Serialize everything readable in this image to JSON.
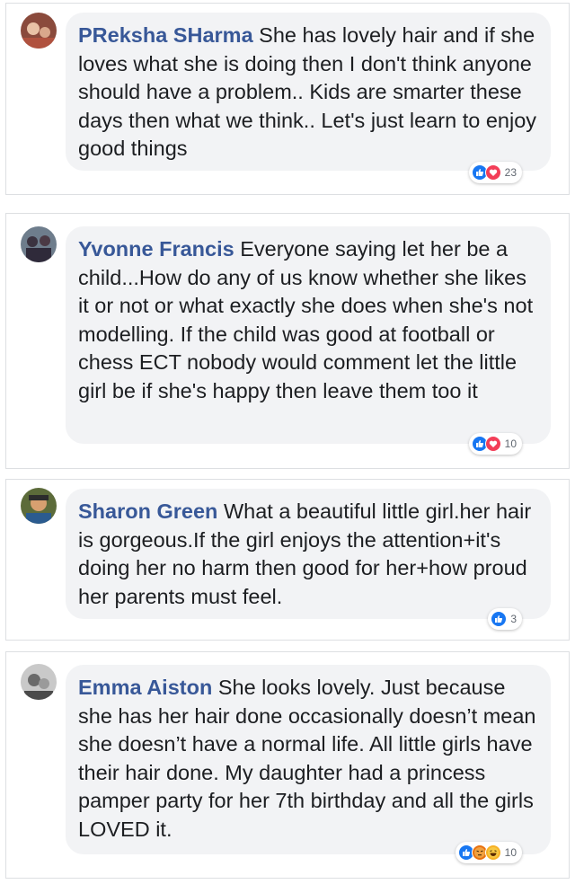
{
  "colors": {
    "author": "#385898",
    "bubble": "#f2f3f5",
    "like": "#1877f2",
    "love": "#f33e58",
    "haha": "#f7b125"
  },
  "comments": [
    {
      "author": "PReksha SHarma",
      "text": "She has lovely hair and if she loves what she is doing then I don't think anyone should have a problem.. Kids are smarter these days then what we think.. Let's just learn to enjoy good things",
      "reactions": [
        "like-icon",
        "love-icon"
      ],
      "count": "23"
    },
    {
      "author": "Yvonne Francis",
      "text": "Everyone saying let her be a child...How do any of us know whether she likes it or not or what exactly she does when she's not modelling. If the child was good at football or chess ECT nobody would comment let the little girl be if she's happy then leave them too it",
      "reactions": [
        "like-icon",
        "love-icon"
      ],
      "count": "10"
    },
    {
      "author": "Sharon Green",
      "text": "What a beautiful little girl.her hair is gorgeous.If the girl enjoys the attention+it's doing her no harm then good for her+how proud her parents must feel.",
      "reactions": [
        "like-icon"
      ],
      "count": "3"
    },
    {
      "author": "Emma Aiston",
      "text": "She looks lovely. Just because she has her hair done occasionally doesn’t mean she doesn’t have a normal life. All little girls have their hair done. My daughter had a princess pamper party for her 7th birthday and all the girls LOVED it.",
      "reactions": [
        "like-icon",
        "angry-icon",
        "haha-icon"
      ],
      "count": "10"
    }
  ]
}
